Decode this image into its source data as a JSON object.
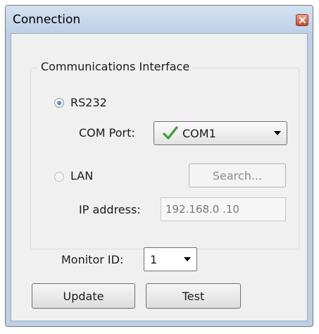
{
  "window": {
    "title": "Connection"
  },
  "group": {
    "title": "Communications Interface"
  },
  "rs232": {
    "label": "RS232",
    "selected": true
  },
  "com_port": {
    "label": "COM Port:",
    "value": "COM1"
  },
  "lan": {
    "label": "LAN",
    "selected": false
  },
  "search_button": {
    "label": "Search..."
  },
  "ip": {
    "label": "IP address:",
    "value": "192.168.0 .10"
  },
  "monitor": {
    "label": "Monitor ID:",
    "value": "1"
  },
  "buttons": {
    "update": "Update",
    "test": "Test"
  },
  "icons": {
    "com_status": "green-check-icon",
    "close": "close-icon"
  },
  "colors": {
    "check_green": "#3a9e2f",
    "radio_blue": "#1c5ea8",
    "close_red": "#c8482d"
  }
}
